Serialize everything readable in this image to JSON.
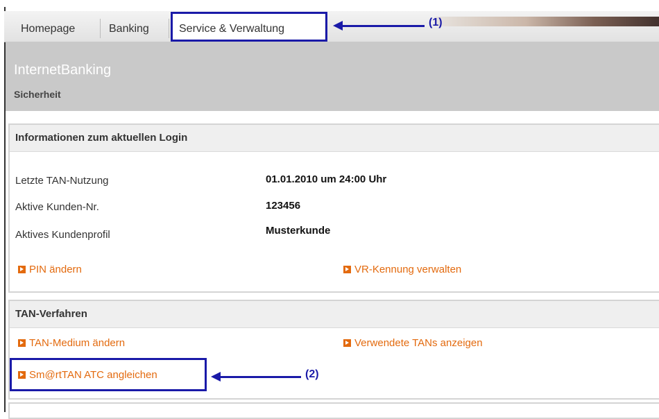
{
  "nav": {
    "items": [
      {
        "label": "Homepage"
      },
      {
        "label": "Banking"
      },
      {
        "label": "Service & Verwaltung"
      }
    ]
  },
  "header": {
    "title": "InternetBanking",
    "subtitle": "Sicherheit"
  },
  "login_info": {
    "heading": "Informationen zum aktuellen Login",
    "rows": [
      {
        "label": "Letzte TAN-Nutzung",
        "value": "01.01.2010 um 24:00 Uhr"
      },
      {
        "label": "Aktive Kunden-Nr.",
        "value": "123456"
      },
      {
        "label": "Aktives Kundenprofil",
        "value": "Musterkunde"
      }
    ],
    "links": [
      {
        "label": "PIN ändern"
      },
      {
        "label": "VR-Kennung verwalten"
      }
    ]
  },
  "tan": {
    "heading": "TAN-Verfahren",
    "links": [
      {
        "label": "TAN-Medium ändern"
      },
      {
        "label": "Verwendete TANs anzeigen"
      },
      {
        "label": "Sm@rtTAN ATC angleichen"
      }
    ]
  },
  "annotations": {
    "marker1": "(1)",
    "marker2": "(2)",
    "color": "#1a1aa8"
  },
  "colors": {
    "link": "#e36a0e",
    "header_bg": "#c9c9c9"
  }
}
